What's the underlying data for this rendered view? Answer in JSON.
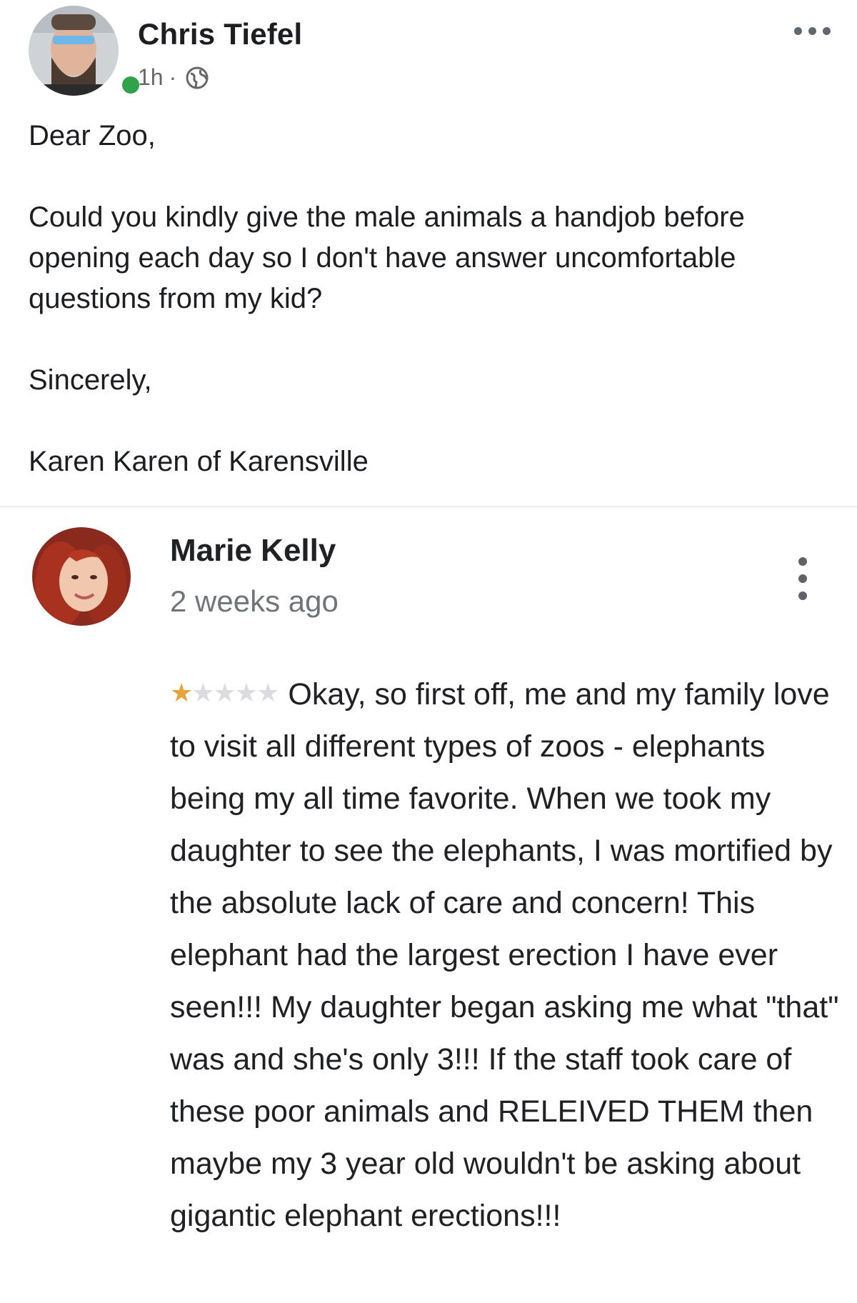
{
  "post": {
    "author": "Chris Tiefel",
    "time": "1h",
    "separator": "·",
    "privacy_icon": "globe-icon",
    "menu_icon": "more-horizontal-icon",
    "online_color": "#31a24c",
    "paragraphs": [
      "Dear Zoo,",
      "Could you kindly give the male animals a handjob before opening each day so I don't have answer uncomfortable questions from my kid?",
      "Sincerely,",
      "Karen Karen of Karensville"
    ]
  },
  "review": {
    "author": "Marie Kelly",
    "time": "2 weeks ago",
    "menu_icon": "more-vertical-icon",
    "rating": 1,
    "rating_max": 5,
    "star_color": "#e7a33a",
    "text": "Okay, so first off, me and my family love to visit all different types of zoos - elephants being my all time favorite. When we took my daughter to see the elephants, I was mortified by the absolute lack of care and concern! This elephant had the largest erection I have ever seen!!! My daughter began asking me what \"that\" was and she's only 3!!! If the staff took care of these poor animals and RELEIVED THEM then maybe my 3 year old wouldn't be asking about gigantic elephant erections!!!"
  }
}
